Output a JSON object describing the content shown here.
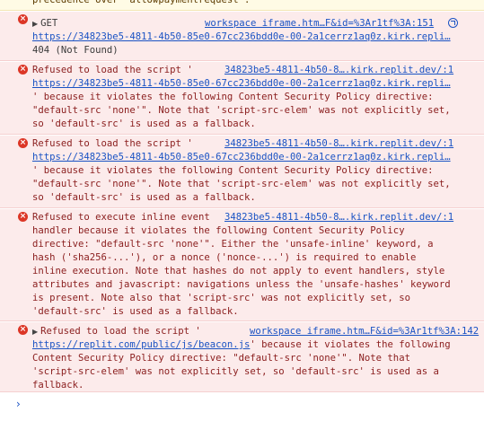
{
  "previous_warning_tail": "precedence over 'allowpaymentrequest'.",
  "messages": [
    {
      "type": "error",
      "prefix": "GET",
      "source": "workspace iframe.htm…F&id=%3Ar1tf%3A:151",
      "url": "https://34823be5-4811-4b50-85e0-67cc236bdd0e-00-2a1cerrz1aq0z.kirk.repli…",
      "status": "404 (Not Found)"
    },
    {
      "type": "error",
      "text_start": "Refused to load the script '",
      "source": "34823be5-4811-4b50-8….kirk.replit.dev/:1",
      "url": "https://34823be5-4811-4b50-85e0-67cc236bdd0e-00-2a1cerrz1aq0z.kirk.repli…",
      "rest": [
        "' because it violates the following Content Security Policy directive:",
        "\"default-src 'none'\". Note that 'script-src-elem' was not explicitly set,",
        "so 'default-src' is used as a fallback."
      ]
    },
    {
      "type": "error",
      "text_start": "Refused to load the script '",
      "source": "34823be5-4811-4b50-8….kirk.replit.dev/:1",
      "url": "https://34823be5-4811-4b50-85e0-67cc236bdd0e-00-2a1cerrz1aq0z.kirk.repli…",
      "rest": [
        "' because it violates the following Content Security Policy directive:",
        "\"default-src 'none'\". Note that 'script-src-elem' was not explicitly set,",
        "so 'default-src' is used as a fallback."
      ]
    },
    {
      "type": "error",
      "text_start": "Refused to execute inline event",
      "source": "34823be5-4811-4b50-8….kirk.replit.dev/:1",
      "rest": [
        "handler because it violates the following Content Security Policy",
        "directive: \"default-src 'none'\". Either the 'unsafe-inline' keyword, a",
        "hash ('sha256-...'), or a nonce ('nonce-...') is required to enable",
        "inline execution. Note that hashes do not apply to event handlers, style",
        "attributes and javascript: navigations unless the 'unsafe-hashes' keyword",
        "is present. Note also that 'script-src' was not explicitly set, so",
        "'default-src' is used as a fallback."
      ]
    },
    {
      "type": "error",
      "text_start": "Refused to load the script '",
      "source": "workspace iframe.htm…F&id=%3Ar1tf%3A:142",
      "url": "https://replit.com/public/js/beacon.js",
      "url_suffix": "' because it violates the following",
      "rest": [
        "Content Security Policy directive: \"default-src 'none'\". Note that",
        "'script-src-elem' was not explicitly set, so 'default-src' is used as a",
        "fallback."
      ]
    }
  ],
  "console_prompt": "›",
  "icons": {
    "error": "error-circle-icon",
    "expand": "triangle-right-icon",
    "network": "network-request-icon"
  },
  "colors": {
    "error_bg": "#fcebeb",
    "error_text": "#8a1d1d",
    "link": "#1a53c4",
    "warning_bg": "#fffbe5"
  }
}
